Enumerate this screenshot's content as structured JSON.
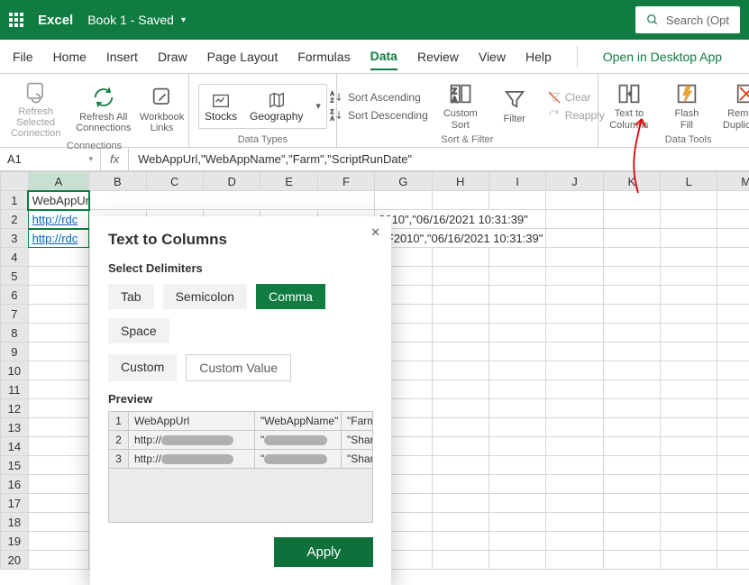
{
  "titlebar": {
    "app": "Excel",
    "doc": "Book 1 - Saved",
    "search_placeholder": "Search (Opt"
  },
  "tabs": {
    "items": [
      "File",
      "Home",
      "Insert",
      "Draw",
      "Page Layout",
      "Formulas",
      "Data",
      "Review",
      "View",
      "Help"
    ],
    "activeIndex": 6,
    "open_in_desktop": "Open in Desktop App"
  },
  "ribbon": {
    "connections_label": "Connections",
    "refresh_selected": "Refresh Selected\nConnection",
    "refresh_all": "Refresh All\nConnections",
    "workbook_links": "Workbook\nLinks",
    "datatypes_label": "Data Types",
    "stocks": "Stocks",
    "geography": "Geography",
    "sortfilter_label": "Sort & Filter",
    "sort_asc": "Sort Ascending",
    "sort_desc": "Sort Descending",
    "custom_sort": "Custom\nSort",
    "filter": "Filter",
    "clear": "Clear",
    "reapply": "Reapply",
    "datatools_label": "Data Tools",
    "text_to_cols": "Text to\nColumns",
    "flash_fill": "Flash\nFill",
    "remove_dup": "Remove\nDuplicates"
  },
  "namebox": "A1",
  "fx": "fx",
  "formula": "WebAppUrl,\"WebAppName\",\"Farm\",\"ScriptRunDate\"",
  "columns": [
    "A",
    "B",
    "C",
    "D",
    "E",
    "F",
    "G",
    "H",
    "I",
    "J",
    "K",
    "L",
    "M"
  ],
  "rows": [
    {
      "n": "1",
      "a": "WebAppUrl,\"WebAppName\",\"Farm\",\"ScriptRunDate\"",
      "a_short": "WebAppUrl",
      "rest": ""
    },
    {
      "n": "2",
      "a": "http://rdc",
      "rest": "2010\",\"06/16/2021 10:31:39\""
    },
    {
      "n": "3",
      "a": "http://rdc",
      "rest": "PF2010\",\"06/16/2021 10:31:39\""
    }
  ],
  "dialog": {
    "title": "Text to Columns",
    "subtitle": "Select Delimiters",
    "chips": [
      "Tab",
      "Semicolon",
      "Comma",
      "Space"
    ],
    "activeChip": 2,
    "custom": "Custom",
    "custom_value": "Custom Value",
    "preview_label": "Preview",
    "apply": "Apply",
    "preview": {
      "header": [
        "",
        "WebAppUrl",
        "\"WebAppName\"",
        "\"Farm\""
      ],
      "rows": [
        {
          "n": "2",
          "c1": "http://",
          "c2": "\"",
          "c3": "\"SharePo"
        },
        {
          "n": "3",
          "c1": "http://",
          "c2": "\"",
          "c3": "\"SharePo"
        }
      ]
    }
  }
}
